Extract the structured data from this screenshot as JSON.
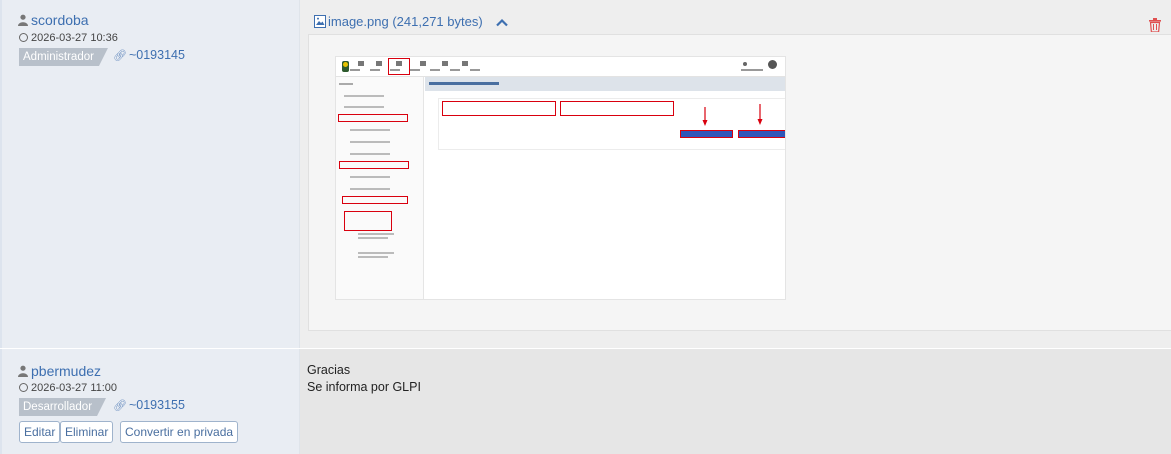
{
  "entries": [
    {
      "author": "scordoba",
      "date": "2026-03-27 10:36",
      "role": "Administrador",
      "ref": "~0193145",
      "attachment": {
        "filename": "image.png",
        "size": "(241,271 bytes)"
      },
      "icons": {
        "user": "user-icon",
        "clock": "clock-icon",
        "link": "link-icon",
        "file": "image-file-icon",
        "collapse": "chevron-up-icon",
        "delete": "trash-icon"
      },
      "colors": {
        "link": "#3d6fb0",
        "badge": "#b8c0ca",
        "delete": "#e05050",
        "highlight": "#d9000e"
      }
    },
    {
      "author": "pbermudez",
      "date": "2026-03-27 11:00",
      "role": "Desarrollador",
      "ref": "~0193155",
      "actions": {
        "edit": "Editar",
        "delete": "Eliminar",
        "private": "Convertir en privada"
      },
      "message": {
        "line1": "Gracias",
        "line2": "Se informa por GLPI"
      }
    }
  ]
}
